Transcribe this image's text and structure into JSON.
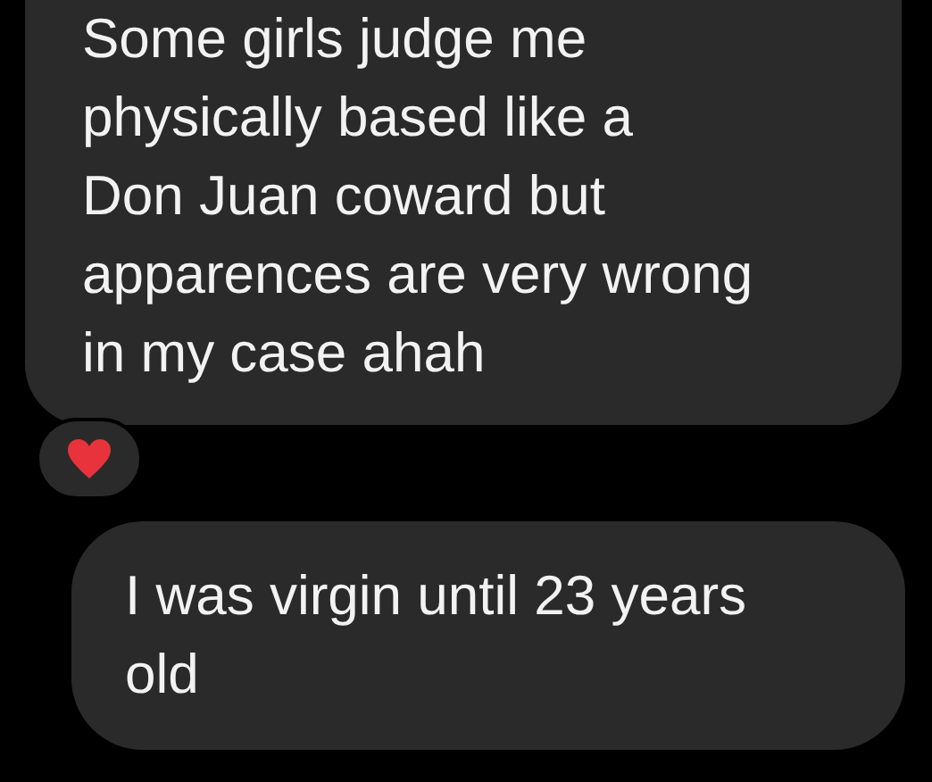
{
  "messages": [
    {
      "text": "Some girls judge me\nphysically based like a\nDon Juan coward but\napparences are very wrong\nin my case ahah",
      "reacted": true
    },
    {
      "text": "I was virgin until 23 years\nold",
      "reacted": false
    }
  ]
}
